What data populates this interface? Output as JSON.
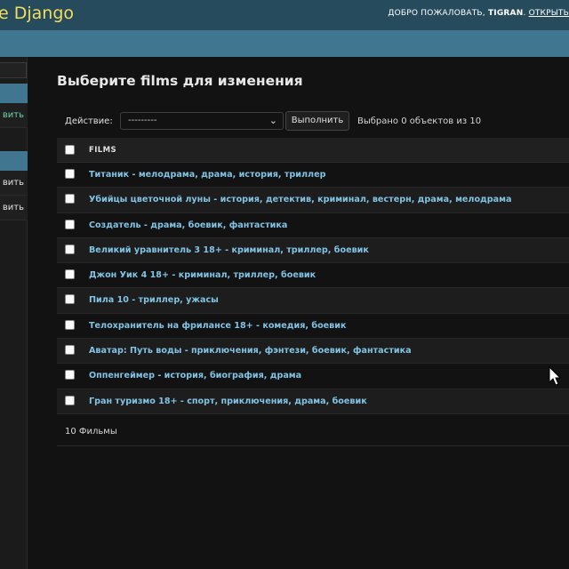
{
  "header": {
    "brand": "e Django",
    "welcome": "ДОБРО ПОЖАЛОВАТЬ, ",
    "username": "TIGRAN",
    "separator": ". ",
    "open_site": "ОТКРЫТЬ"
  },
  "sidebar": {
    "items": [
      {
        "label": "вить"
      },
      {
        "label": "вить"
      },
      {
        "label": "вить"
      }
    ]
  },
  "main": {
    "title": "Выберите films для изменения",
    "actions": {
      "label": "Действие:",
      "selected_option": "---------",
      "submit": "Выполнить",
      "counter": "Выбрано 0 объектов из 10"
    },
    "table": {
      "column": "FILMS",
      "rows": [
        "Титаник - мелодрама, драма, история, триллер",
        "Убийцы цветочной луны - история, детектив, криминал, вестерн, драма, мелодрама",
        "Создатель - драма, боевик, фантастика",
        "Великий уравнитель 3 18+ - криминал, триллер, боевик",
        "Джон Уик 4 18+ - криминал, триллер, боевик",
        "Пила 10 - триллер, ужасы",
        "Телохранитель на фрилансе 18+ - комедия, боевик",
        "Аватар: Путь воды - приключения, фэнтези, боевик, фантастика",
        "Оппенгеймер - история, биография, драма",
        "Гран туризмо 18+ - спорт, приключения, драма, боевик"
      ]
    },
    "paginator": "10 Фильмы"
  }
}
